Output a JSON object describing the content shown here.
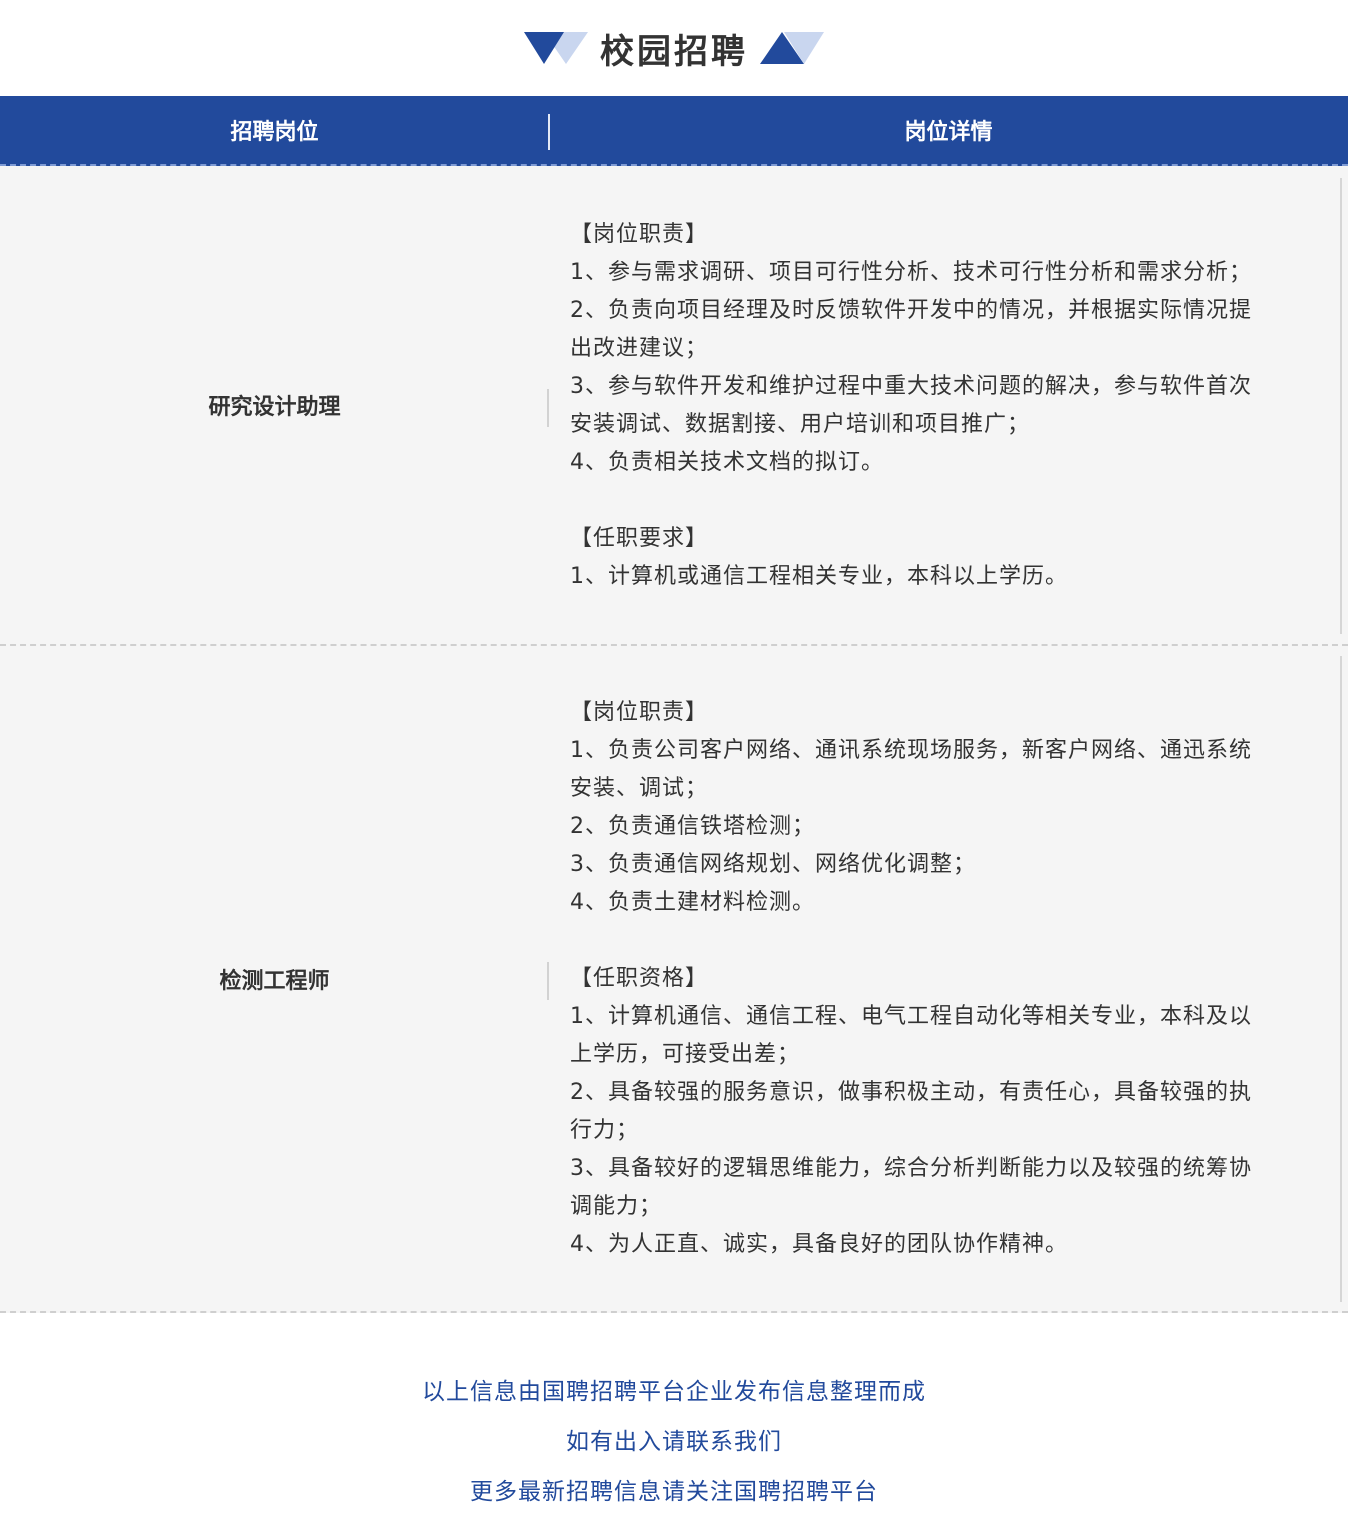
{
  "title": "校园招聘",
  "colors": {
    "brand_blue": "#224a9c",
    "light_blue": "#c9d6ef",
    "row_bg": "#f5f5f5"
  },
  "table": {
    "headers": [
      "招聘岗位",
      "岗位详情"
    ],
    "rows": [
      {
        "position": "研究设计助理",
        "sections": [
          {
            "heading": "【岗位职责】",
            "items": [
              "1、参与需求调研、项目可行性分析、技术可行性分析和需求分析；",
              "2、负责向项目经理及时反馈软件开发中的情况，并根据实际情况提",
              "出改进建议；",
              "3、参与软件开发和维护过程中重大技术问题的解决，参与软件首次",
              "安装调试、数据割接、用户培训和项目推广；",
              "4、负责相关技术文档的拟订。"
            ]
          },
          {
            "heading": "【任职要求】",
            "items": [
              "1、计算机或通信工程相关专业，本科以上学历。"
            ]
          }
        ]
      },
      {
        "position": "检测工程师",
        "sections": [
          {
            "heading": "【岗位职责】",
            "items": [
              "1、负责公司客户网络、通讯系统现场服务，新客户网络、通迅系统",
              "安装、调试；",
              "2、负责通信铁塔检测；",
              "3、负责通信网络规划、网络优化调整；",
              "4、负责土建材料检测。"
            ]
          },
          {
            "heading": "【任职资格】",
            "items": [
              "1、计算机通信、通信工程、电气工程自动化等相关专业，本科及以",
              "上学历，可接受出差；",
              "2、具备较强的服务意识，做事积极主动，有责任心，具备较强的执",
              "行力；",
              "3、具备较好的逻辑思维能力，综合分析判断能力以及较强的统筹协",
              "调能力；",
              "4、为人正直、诚实，具备良好的团队协作精神。"
            ]
          }
        ]
      }
    ]
  },
  "footer": {
    "lines": [
      "以上信息由国聘招聘平台企业发布信息整理而成",
      "如有出入请联系我们",
      "更多最新招聘信息请关注国聘招聘平台"
    ]
  }
}
